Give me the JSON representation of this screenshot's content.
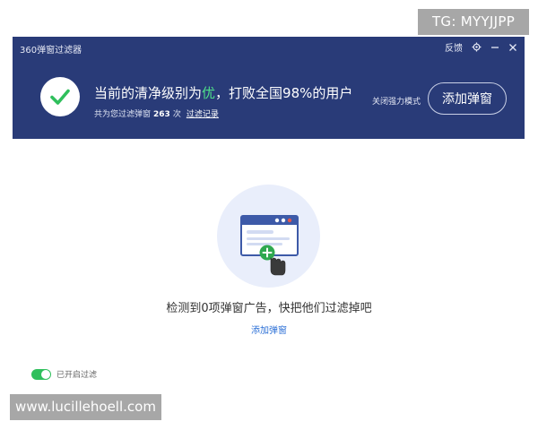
{
  "watermarks": {
    "tg": "TG: MYYJJPP",
    "site": "www.lucillehoell.com"
  },
  "window": {
    "title": "360弹窗过滤器",
    "feedback": "反馈",
    "settings_icon": "gear-icon",
    "minimize_icon": "minimize-icon",
    "close_icon": "close-icon"
  },
  "status": {
    "prefix": "当前的清净级别为",
    "level": "优",
    "suffix": "，打败全国98%的用户",
    "filtered_prefix": "共为您过滤弹窗",
    "filtered_count": "263",
    "filtered_unit": "次",
    "history_link": "过滤记录",
    "strong_mode": "关闭强力模式",
    "add_button": "添加弹窗"
  },
  "main": {
    "empty_text": "检测到0项弹窗广告，快把他们过滤掉吧",
    "add_link": "添加弹窗"
  },
  "footer": {
    "toggle_label": "已开启过滤",
    "toggle_on": true
  },
  "colors": {
    "header_bg": "#293b78",
    "accent_green": "#2fbf5c",
    "link_blue": "#2b6fd6"
  }
}
